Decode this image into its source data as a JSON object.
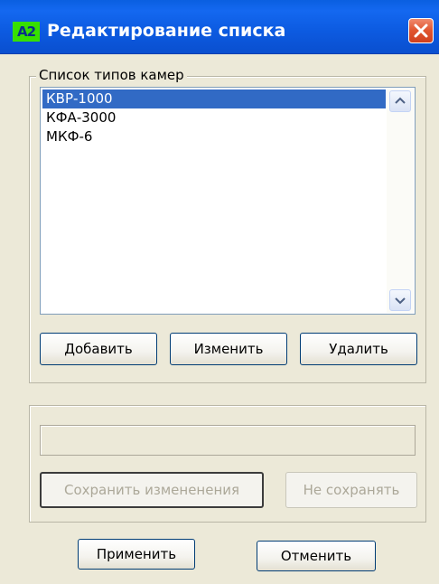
{
  "window": {
    "app_badge": "A2",
    "title": "Редактирование списка"
  },
  "camera_group": {
    "legend": "Список типов камер",
    "items": [
      {
        "label": "КВР-1000",
        "selected": true
      },
      {
        "label": "КФА-3000",
        "selected": false
      },
      {
        "label": "МКФ-6",
        "selected": false
      }
    ],
    "add_label": "Добавить",
    "edit_label": "Изменить",
    "delete_label": "Удалить"
  },
  "edit_group": {
    "field_value": "",
    "save_label": "Сохранить измененения",
    "discard_label": "Не сохранять"
  },
  "footer": {
    "apply_label": "Применить",
    "cancel_label": "Отменить"
  },
  "colors": {
    "titlebar": "#0a5fe0",
    "selection": "#316ac5",
    "badge": "#37e000",
    "close": "#e0542e",
    "dialog_bg": "#ece9d8"
  }
}
